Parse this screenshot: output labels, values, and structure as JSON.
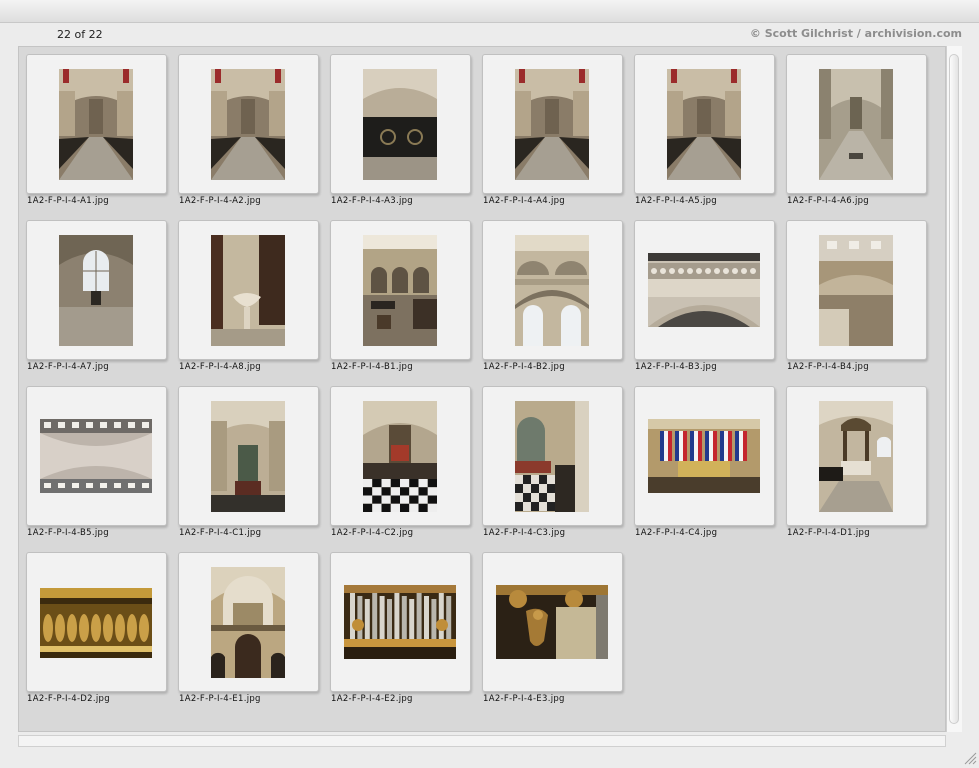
{
  "header": {
    "count": "22 of 22",
    "credit": "© Scott Gilchrist / archivision.com"
  },
  "thumbnails": [
    {
      "file": "1A2-F-P-I-4-A1.jpg",
      "orientation": "portrait",
      "icon": "nave-photo-icon"
    },
    {
      "file": "1A2-F-P-I-4-A2.jpg",
      "orientation": "portrait",
      "icon": "nave-photo-icon"
    },
    {
      "file": "1A2-F-P-I-4-A3.jpg",
      "orientation": "portrait",
      "icon": "railing-photo-icon"
    },
    {
      "file": "1A2-F-P-I-4-A4.jpg",
      "orientation": "portrait",
      "icon": "nave-photo-icon"
    },
    {
      "file": "1A2-F-P-I-4-A5.jpg",
      "orientation": "portrait",
      "icon": "nave-photo-icon"
    },
    {
      "file": "1A2-F-P-I-4-A6.jpg",
      "orientation": "portrait",
      "icon": "aisle-photo-icon"
    },
    {
      "file": "1A2-F-P-I-4-A7.jpg",
      "orientation": "portrait",
      "icon": "window-photo-icon"
    },
    {
      "file": "1A2-F-P-I-4-A8.jpg",
      "orientation": "portrait",
      "icon": "font-photo-icon"
    },
    {
      "file": "1A2-F-P-I-4-B1.jpg",
      "orientation": "portrait",
      "icon": "arcade-photo-icon"
    },
    {
      "file": "1A2-F-P-I-4-B2.jpg",
      "orientation": "portrait",
      "icon": "upper-arches-photo-icon"
    },
    {
      "file": "1A2-F-P-I-4-B3.jpg",
      "orientation": "landscape",
      "icon": "balustrade-photo-icon"
    },
    {
      "file": "1A2-F-P-I-4-B4.jpg",
      "orientation": "portrait",
      "icon": "gallery-photo-icon"
    },
    {
      "file": "1A2-F-P-I-4-B5.jpg",
      "orientation": "landscape",
      "icon": "ceiling-photo-icon"
    },
    {
      "file": "1A2-F-P-I-4-C1.jpg",
      "orientation": "portrait",
      "icon": "organ-nave-photo-icon"
    },
    {
      "file": "1A2-F-P-I-4-C2.jpg",
      "orientation": "portrait",
      "icon": "checkered-floor-photo-icon"
    },
    {
      "file": "1A2-F-P-I-4-C3.jpg",
      "orientation": "portrait",
      "icon": "side-altar-photo-icon"
    },
    {
      "file": "1A2-F-P-I-4-C4.jpg",
      "orientation": "landscape",
      "icon": "flags-photo-icon"
    },
    {
      "file": "1A2-F-P-I-4-D1.jpg",
      "orientation": "portrait",
      "icon": "canopy-photo-icon"
    },
    {
      "file": "1A2-F-P-I-4-D2.jpg",
      "orientation": "land-wide",
      "icon": "gilded-relief-photo-icon"
    },
    {
      "file": "1A2-F-P-I-4-E1.jpg",
      "orientation": "portrait",
      "icon": "organ-loft-photo-icon"
    },
    {
      "file": "1A2-F-P-I-4-E2.jpg",
      "orientation": "landscape",
      "icon": "organ-pipes-photo-icon"
    },
    {
      "file": "1A2-F-P-I-4-E3.jpg",
      "orientation": "landscape",
      "icon": "carved-figure-photo-icon"
    }
  ]
}
